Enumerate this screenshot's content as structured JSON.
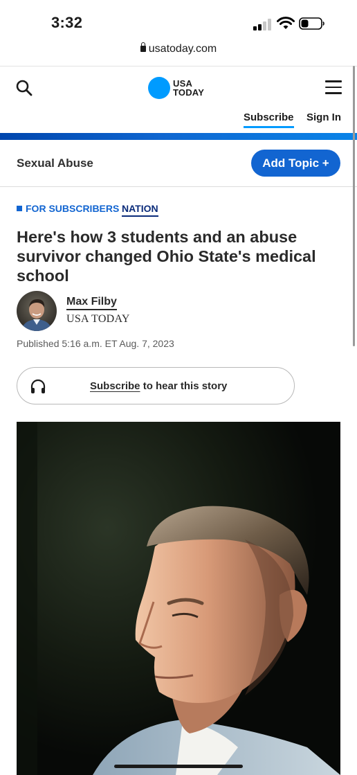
{
  "status_bar": {
    "time": "3:32"
  },
  "browser": {
    "url": "usatoday.com"
  },
  "header": {
    "logo_line1": "USA",
    "logo_line2": "TODAY",
    "subscribe": "Subscribe",
    "sign_in": "Sign In",
    "colors": {
      "brand_blue": "#009bff",
      "button_blue": "#1265d1"
    }
  },
  "topic": {
    "label": "Sexual Abuse",
    "add_button": "Add Topic +"
  },
  "article": {
    "badge": "FOR SUBSCRIBERS",
    "section": "NATION",
    "headline": "Here's how 3 students and an abuse survivor changed Ohio State's medical school",
    "author": "Max Filby",
    "organization": "USA TODAY",
    "published": "Published 5:16 a.m. ET Aug. 7, 2023",
    "audio": {
      "link": "Subscribe",
      "rest": " to hear this story"
    }
  }
}
